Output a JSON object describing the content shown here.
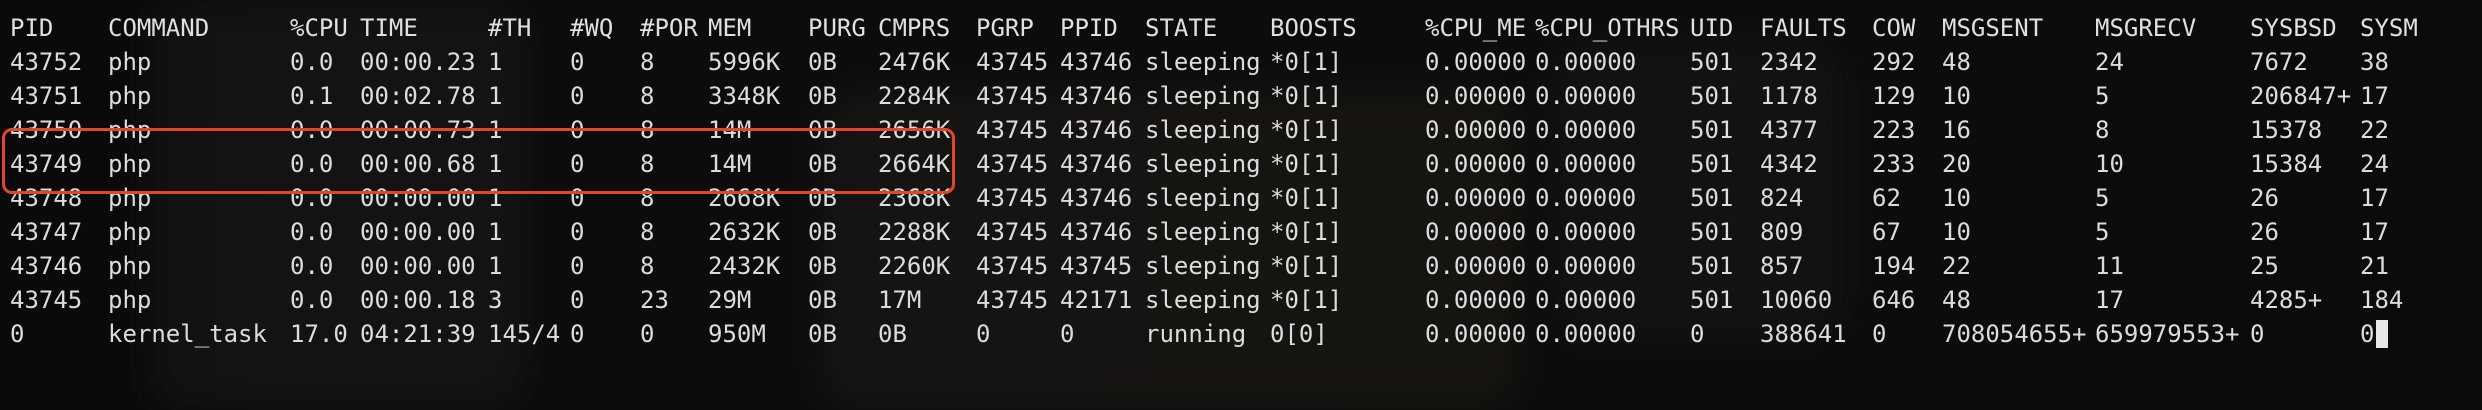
{
  "columns": [
    "PID",
    "COMMAND",
    "%CPU",
    "TIME",
    "#TH",
    "#WQ",
    "#POR",
    "MEM",
    "PURG",
    "CMPRS",
    "PGRP",
    "PPID",
    "STATE",
    "BOOSTS",
    "%CPU_ME",
    "%CPU_OTHRS",
    "UID",
    "FAULTS",
    "COW",
    "MSGSENT",
    "MSGRECV",
    "SYSBSD",
    "SYSM"
  ],
  "rows": [
    [
      "43752",
      "php",
      "0.0",
      "00:00.23",
      "1",
      "0",
      "8",
      "5996K",
      "0B",
      "2476K",
      "43745",
      "43746",
      "sleeping",
      "*0[1]",
      "0.00000",
      "0.00000",
      "501",
      "2342",
      "292",
      "48",
      "24",
      "7672",
      "38"
    ],
    [
      "43751",
      "php",
      "0.1",
      "00:02.78",
      "1",
      "0",
      "8",
      "3348K",
      "0B",
      "2284K",
      "43745",
      "43746",
      "sleeping",
      "*0[1]",
      "0.00000",
      "0.00000",
      "501",
      "1178",
      "129",
      "10",
      "5",
      "206847+",
      "17"
    ],
    [
      "43750",
      "php",
      "0.0",
      "00:00.73",
      "1",
      "0",
      "8",
      "14M",
      "0B",
      "2656K",
      "43745",
      "43746",
      "sleeping",
      "*0[1]",
      "0.00000",
      "0.00000",
      "501",
      "4377",
      "223",
      "16",
      "8",
      "15378",
      "22"
    ],
    [
      "43749",
      "php",
      "0.0",
      "00:00.68",
      "1",
      "0",
      "8",
      "14M",
      "0B",
      "2664K",
      "43745",
      "43746",
      "sleeping",
      "*0[1]",
      "0.00000",
      "0.00000",
      "501",
      "4342",
      "233",
      "20",
      "10",
      "15384",
      "24"
    ],
    [
      "43748",
      "php",
      "0.0",
      "00:00.00",
      "1",
      "0",
      "8",
      "2668K",
      "0B",
      "2368K",
      "43745",
      "43746",
      "sleeping",
      "*0[1]",
      "0.00000",
      "0.00000",
      "501",
      "824",
      "62",
      "10",
      "5",
      "26",
      "17"
    ],
    [
      "43747",
      "php",
      "0.0",
      "00:00.00",
      "1",
      "0",
      "8",
      "2632K",
      "0B",
      "2288K",
      "43745",
      "43746",
      "sleeping",
      "*0[1]",
      "0.00000",
      "0.00000",
      "501",
      "809",
      "67",
      "10",
      "5",
      "26",
      "17"
    ],
    [
      "43746",
      "php",
      "0.0",
      "00:00.00",
      "1",
      "0",
      "8",
      "2432K",
      "0B",
      "2260K",
      "43745",
      "43745",
      "sleeping",
      "*0[1]",
      "0.00000",
      "0.00000",
      "501",
      "857",
      "194",
      "22",
      "11",
      "25",
      "21"
    ],
    [
      "43745",
      "php",
      "0.0",
      "00:00.18",
      "3",
      "0",
      "23",
      "29M",
      "0B",
      "17M",
      "43745",
      "42171",
      "sleeping",
      "*0[1]",
      "0.00000",
      "0.00000",
      "501",
      "10060",
      "646",
      "48",
      "17",
      "4285+",
      "184"
    ],
    [
      "0",
      "kernel_task",
      "17.0",
      "04:21:39",
      "145/4",
      "0",
      "0",
      "950M",
      "0B",
      "0B",
      "0",
      "0",
      "running",
      "0[0]",
      "0.00000",
      "0.00000",
      "0",
      "388641",
      "0",
      "708054655+",
      "659979553+",
      "0",
      "0"
    ]
  ],
  "highlight_color": "#e2452a",
  "text_color": "#dcdcdc",
  "background_color": "#0b0b0d"
}
